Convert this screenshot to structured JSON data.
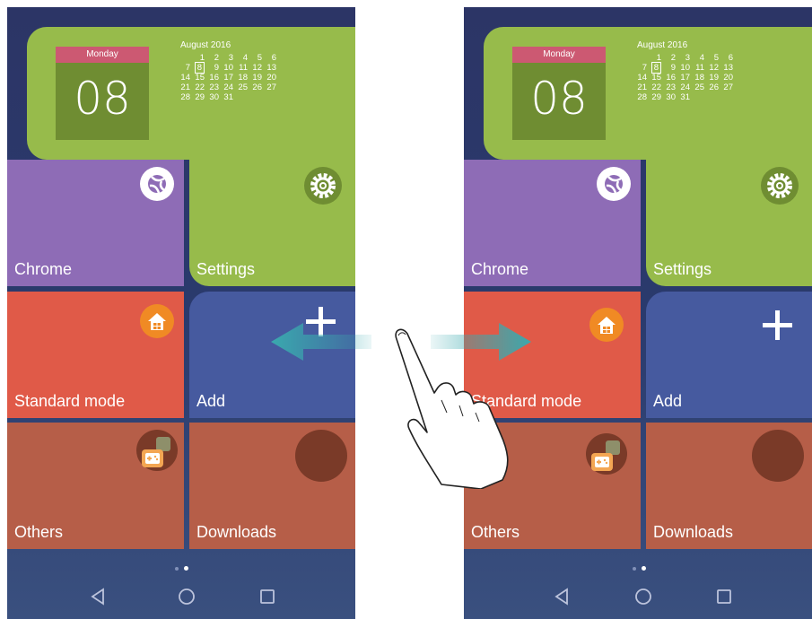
{
  "phones": [
    {
      "calendar": {
        "day_name": "Monday",
        "day_number": "08",
        "month_title": "August 2016"
      },
      "tiles": {
        "chrome": "Chrome",
        "settings": "Settings",
        "standard_mode": "Standard mode",
        "add": "Add",
        "others": "Others",
        "downloads": "Downloads"
      }
    },
    {
      "calendar": {
        "day_name": "Monday",
        "day_number": "08",
        "month_title": "August 2016"
      },
      "tiles": {
        "chrome": "Chrome",
        "settings": "Settings",
        "standard_mode": "Standard mode",
        "add": "Add",
        "others": "Others",
        "downloads": "Downloads"
      }
    }
  ],
  "month_weeks": [
    [
      "",
      "1",
      "2",
      "3",
      "4",
      "5",
      "6"
    ],
    [
      "7",
      "8",
      "9",
      "10",
      "11",
      "12",
      "13"
    ],
    [
      "14",
      "15",
      "16",
      "17",
      "18",
      "19",
      "20"
    ],
    [
      "21",
      "22",
      "23",
      "24",
      "25",
      "26",
      "27"
    ],
    [
      "28",
      "29",
      "30",
      "31",
      "",
      "",
      ""
    ]
  ],
  "today": "8",
  "pager": {
    "pages": 2,
    "active_index": 1
  },
  "icons": [
    "chrome-icon",
    "settings-gear-icon",
    "home-icon",
    "plus-icon",
    "gamepad-icon",
    "downloads-icon",
    "back-icon",
    "home-circle-icon",
    "recent-apps-icon",
    "swipe-left-arrow-icon",
    "swipe-right-arrow-icon",
    "hand-pointer-icon"
  ],
  "colors": {
    "calendar_green": "#97bb4b",
    "chrome_purple": "#8e6cb6",
    "standard_red": "#e05a48",
    "add_blue": "#465a9f",
    "others_brown": "#b65e48",
    "background_navy": "#2c3566",
    "arrow_teal": "#3aa9ae"
  }
}
